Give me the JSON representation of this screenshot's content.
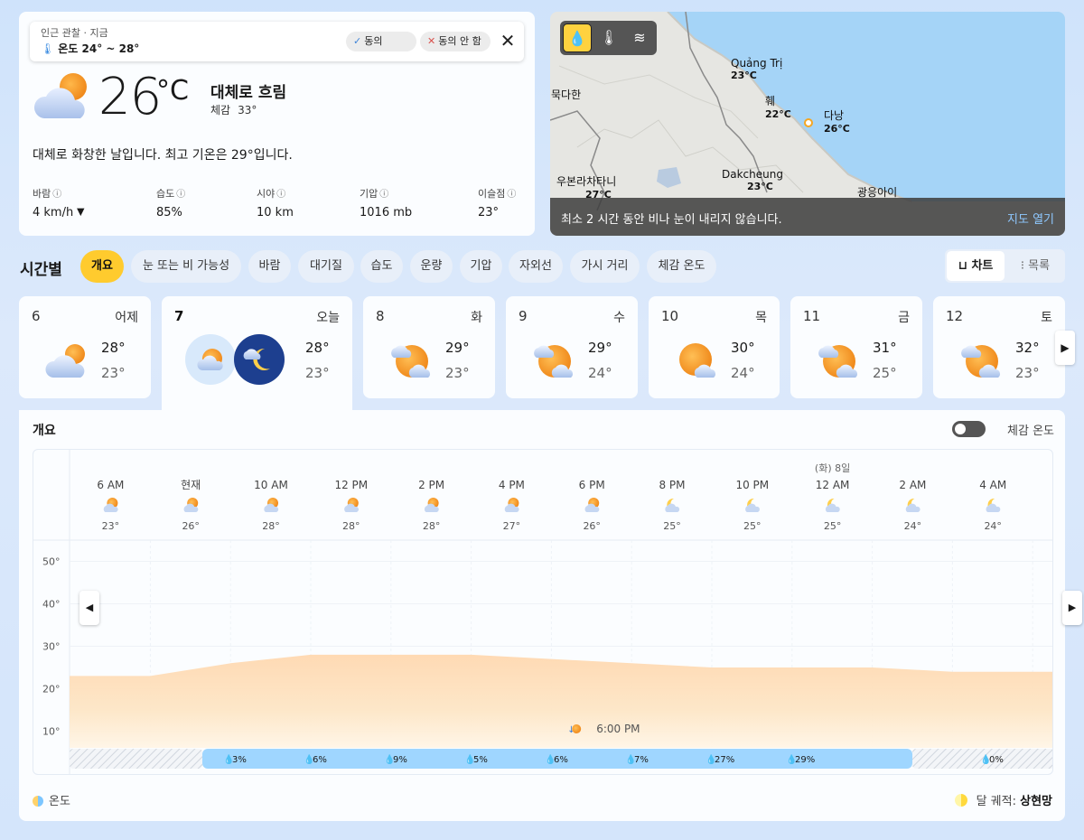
{
  "current": {
    "banner": {
      "title": "인근 관찰 · 지금",
      "temp_range": "온도 24° ~ 28°",
      "agree_label": "동의",
      "disagree_label": "동의 안 함"
    },
    "temperature": "26",
    "unit": "°C",
    "condition": "대체로 흐림",
    "feels_label": "체감",
    "feels_value": "33°",
    "summary": "대체로 화창한 날입니다. 최고 기온은 29°입니다.",
    "metrics": [
      {
        "label": "바람",
        "value": "4 km/h"
      },
      {
        "label": "습도",
        "value": "85%"
      },
      {
        "label": "시야",
        "value": "10 km"
      },
      {
        "label": "기압",
        "value": "1016 mb"
      },
      {
        "label": "이슬점",
        "value": "23°"
      }
    ]
  },
  "map": {
    "cities": [
      {
        "name": "Quảng Trị",
        "temp": "23°C"
      },
      {
        "name": "훼",
        "temp": "22°C"
      },
      {
        "name": "다낭",
        "temp": "26°C"
      },
      {
        "name": "묵다한",
        "temp": ""
      },
      {
        "name": "우본라차타니",
        "temp": "27°C"
      },
      {
        "name": "Dakcheung",
        "temp": "23°C"
      },
      {
        "name": "광응아이",
        "temp": ""
      }
    ],
    "status": "최소 2 시간 동안 비나 눈이 내리지 않습니다.",
    "open_label": "지도 열기",
    "layers": [
      "precipitation-icon",
      "thermometer-icon",
      "wind-icon"
    ]
  },
  "hourly": {
    "title": "시간별",
    "tabs": [
      "개요",
      "눈 또는 비 가능성",
      "바람",
      "대기질",
      "습도",
      "운량",
      "기압",
      "자외선",
      "가시 거리",
      "체감 온도"
    ],
    "view_chart": "차트",
    "view_list": "목록"
  },
  "days": [
    {
      "num": "6",
      "name": "어제",
      "hi": "28°",
      "lo": "23°"
    },
    {
      "num": "7",
      "name": "오늘",
      "hi": "28°",
      "lo": "23°"
    },
    {
      "num": "8",
      "name": "화",
      "hi": "29°",
      "lo": "23°"
    },
    {
      "num": "9",
      "name": "수",
      "hi": "29°",
      "lo": "24°"
    },
    {
      "num": "10",
      "name": "목",
      "hi": "30°",
      "lo": "24°"
    },
    {
      "num": "11",
      "name": "금",
      "hi": "31°",
      "lo": "25°"
    },
    {
      "num": "12",
      "name": "토",
      "hi": "32°",
      "lo": "23°"
    }
  ],
  "overview": {
    "title": "개요",
    "feels_toggle_label": "체감 온도",
    "legend_temp": "온도",
    "moon_label": "달 궤적:",
    "moon_phase": "상현망",
    "sunset_label": "6:00 PM"
  },
  "chart_data": {
    "type": "area",
    "x": [
      "6 AM",
      "현재",
      "10 AM",
      "12 PM",
      "2 PM",
      "4 PM",
      "6 PM",
      "8 PM",
      "10 PM",
      "12 AM",
      "2 AM",
      "4 AM"
    ],
    "day_marker": {
      "at": "12 AM",
      "label": "(화) 8일"
    },
    "temperature": [
      23,
      26,
      28,
      28,
      28,
      27,
      26,
      25,
      25,
      25,
      24,
      24
    ],
    "temperature_labels": [
      "23°",
      "26°",
      "28°",
      "28°",
      "28°",
      "27°",
      "26°",
      "25°",
      "25°",
      "25°",
      "24°",
      "24°"
    ],
    "precip_chance_labels": [
      "3%",
      "6%",
      "9%",
      "5%",
      "6%",
      "7%",
      "27%",
      "29%",
      "0%"
    ],
    "yticks": [
      "50°",
      "40°",
      "30°",
      "20°",
      "10°"
    ],
    "ylim": [
      5,
      55
    ],
    "grid": true
  }
}
